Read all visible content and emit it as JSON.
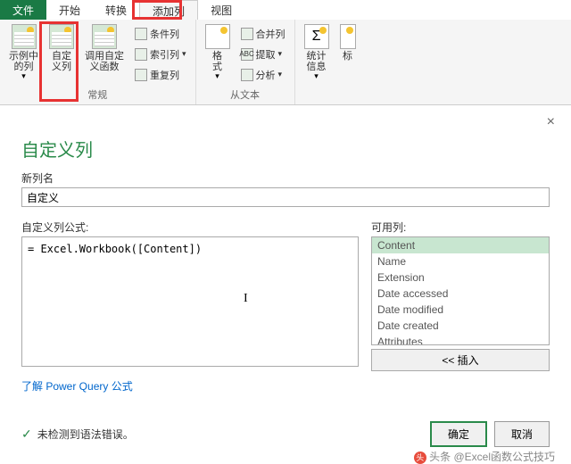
{
  "tabs": {
    "file": "文件",
    "home": "开始",
    "transform": "转换",
    "add": "添加列",
    "view": "视图"
  },
  "ribbon": {
    "group1": {
      "label": "常规",
      "btn1": "示例中\n的列",
      "btn2": "自定\n义列",
      "btn3": "调用自定\n义函数",
      "s1": "条件列",
      "s2": "索引列",
      "s3": "重复列"
    },
    "group2": {
      "label": "",
      "btn": "格\n式"
    },
    "group3": {
      "label": "从文本",
      "s1": "合并列",
      "s2": "提取",
      "s3": "分析"
    },
    "group4": {
      "label": "",
      "btn": "统计\n信息",
      "btn2": "标"
    }
  },
  "dialog": {
    "title": "自定义列",
    "newcol_label": "新列名",
    "newcol_value": "自定义",
    "formula_label": "自定义列公式:",
    "formula_value": "= Excel.Workbook([Content])",
    "avail_label": "可用列:",
    "avail_items": [
      "Content",
      "Name",
      "Extension",
      "Date accessed",
      "Date modified",
      "Date created",
      "Attributes"
    ],
    "insert": "<< 插入",
    "link": "了解 Power Query 公式",
    "status": "未检测到语法错误。",
    "ok": "确定",
    "cancel": "取消"
  },
  "watermark": "头条 @Excel函数公式技巧"
}
